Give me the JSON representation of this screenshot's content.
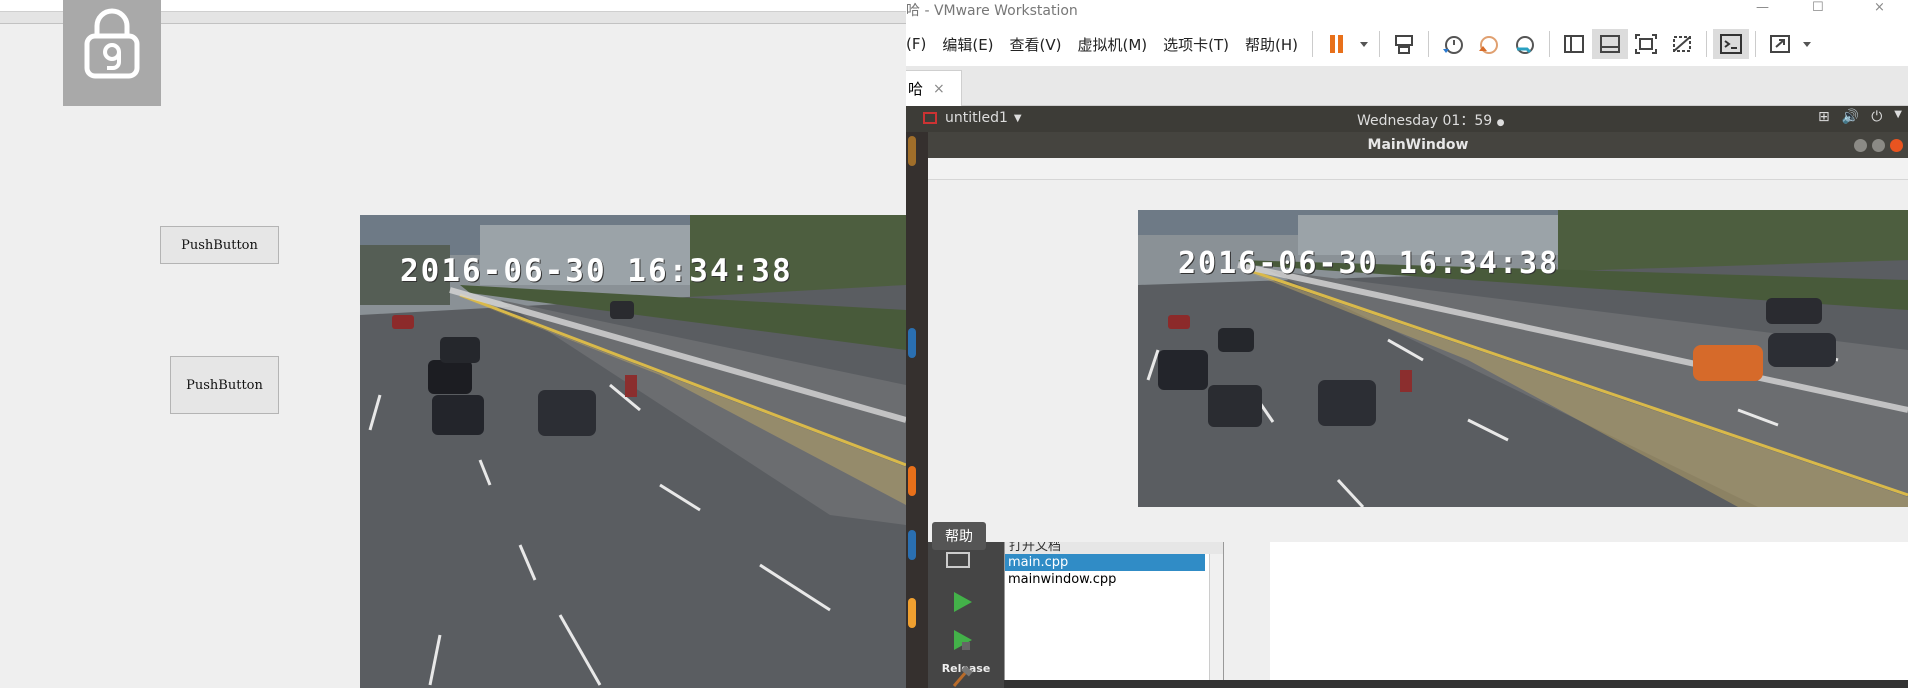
{
  "left_app": {
    "buttons": [
      {
        "label": "PushButton"
      },
      {
        "label": "PushButton"
      }
    ],
    "video_timestamp": "2016-06-30 16:34:38"
  },
  "vmware": {
    "title_fragment": "哈 - VMware Workstation",
    "menu": [
      "(F)",
      "编辑(E)",
      "查看(V)",
      "虚拟机(M)",
      "选项卡(T)",
      "帮助(H)"
    ],
    "tab_label": "哈",
    "tab_close": "×",
    "window_controls": [
      "—",
      "☐",
      "×"
    ]
  },
  "guest": {
    "app_name": "untitled1",
    "clock": "Wednesday 01：59",
    "mainwindow_title": "MainWindow",
    "video_timestamp": "2016-06-30 16:34:38"
  },
  "creator": {
    "help_tooltip": "帮助",
    "release_label": "Release",
    "open_docs_header": "打开文档",
    "open_files": [
      "main.cpp",
      "mainwindow.cpp"
    ]
  },
  "colors": {
    "pause_orange": "#e8701a",
    "selection_blue": "#308cc6",
    "ubuntu_bar": "#3d3c37"
  }
}
